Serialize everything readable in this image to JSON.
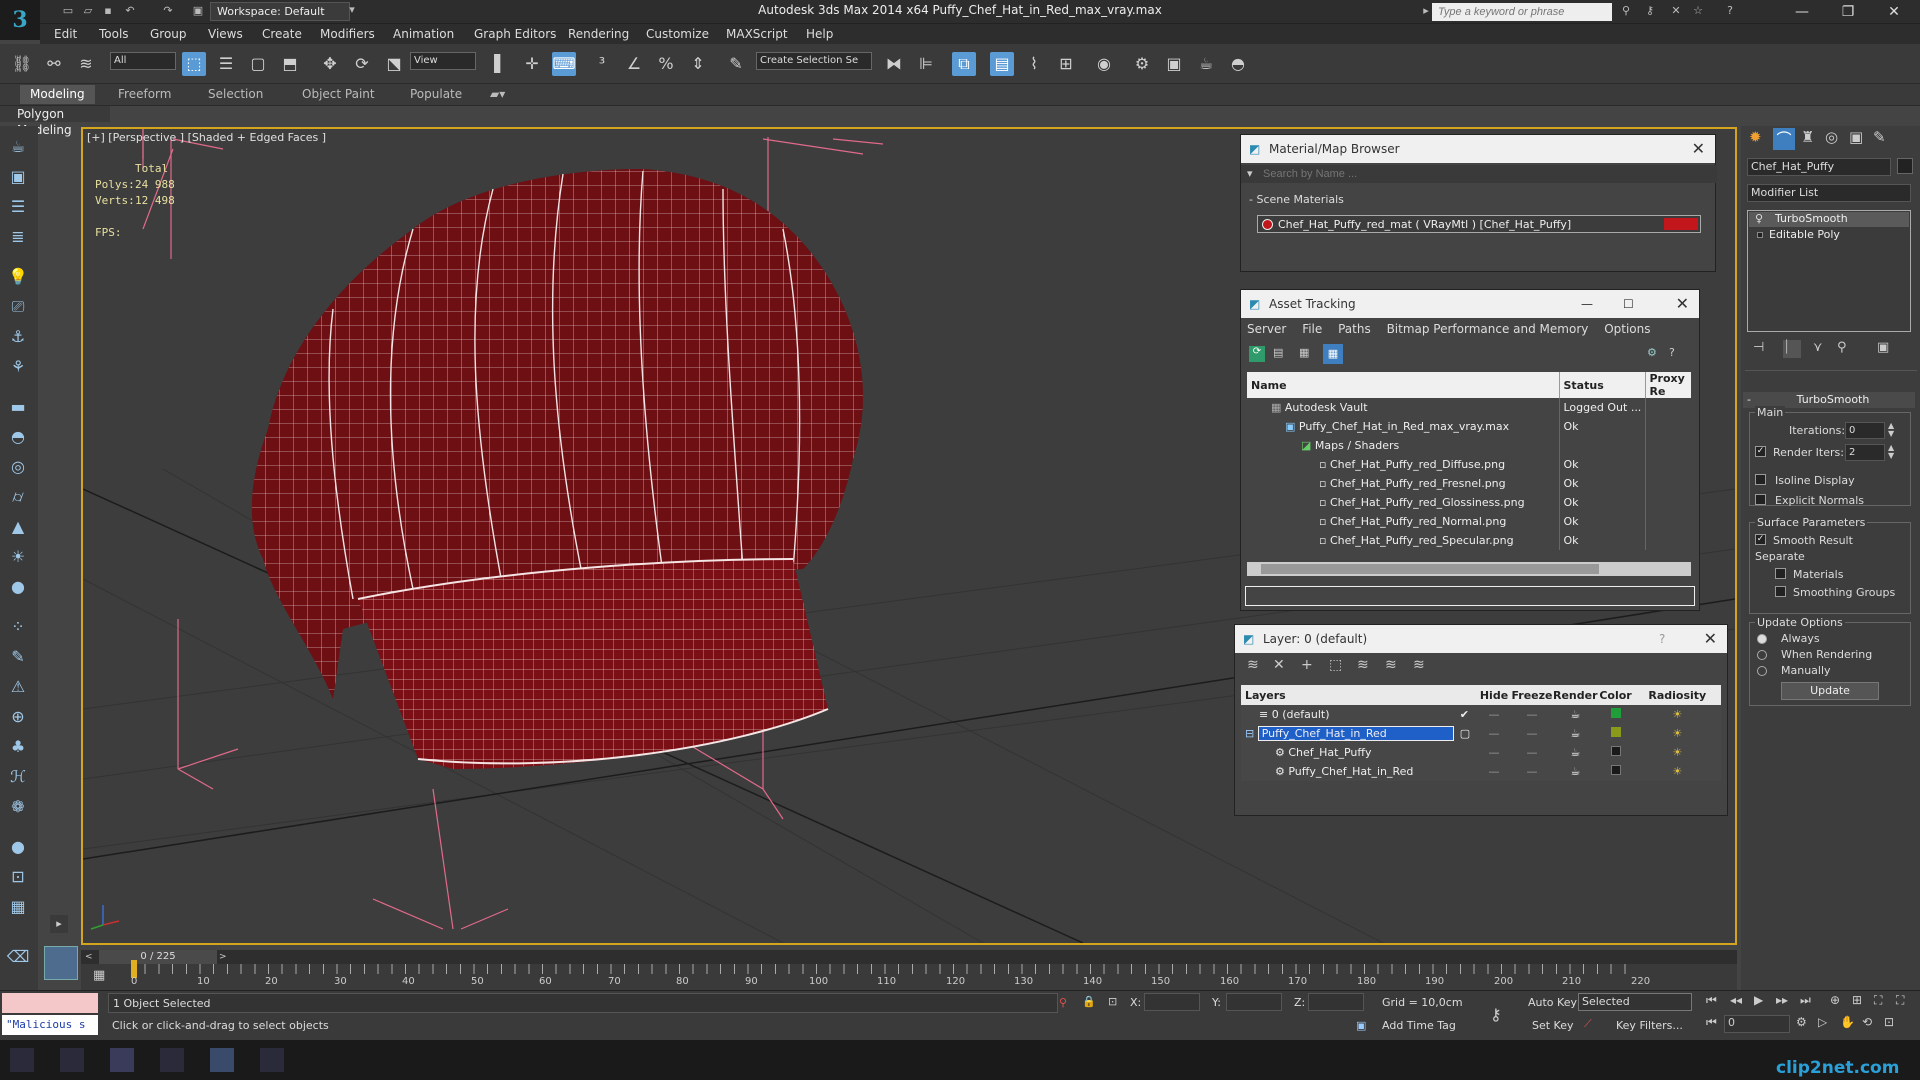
{
  "window": {
    "app_title": "Autodesk 3ds Max  2014 x64     Puffy_Chef_Hat_in_Red_max_vray.max",
    "workspace": "Workspace: Default",
    "search_placeholder": "Type a keyword or phrase"
  },
  "menu": [
    "Edit",
    "Tools",
    "Group",
    "Views",
    "Create",
    "Modifiers",
    "Animation",
    "Graph Editors",
    "Rendering",
    "Customize",
    "MAXScript",
    "Help"
  ],
  "toolbar": {
    "selection_filter": "All",
    "ref_coord": "View",
    "named_selection": "Create Selection Se"
  },
  "ribbon": {
    "tabs": [
      "Modeling",
      "Freeform",
      "Selection",
      "Object Paint",
      "Populate"
    ],
    "active": "Modeling",
    "sub": "Polygon Modeling"
  },
  "viewport": {
    "label": "[+] [Perspective ] [Shaded + Edged Faces ]",
    "stats_header": "Total",
    "polys_label": "Polys:",
    "polys_value": "24 988",
    "verts_label": "Verts:",
    "verts_value": "12 498",
    "fps_label": "FPS:"
  },
  "material_browser": {
    "title": "Material/Map Browser",
    "search_placeholder": "Search by Name ...",
    "section": "- Scene Materials",
    "material": "Chef_Hat_Puffy_red_mat  ( VRayMtl )  [Chef_Hat_Puffy]",
    "swatch_color": "#c0161c"
  },
  "asset_tracking": {
    "title": "Asset Tracking",
    "menu": [
      "Server",
      "File",
      "Paths",
      "Bitmap Performance and Memory",
      "Options"
    ],
    "columns": [
      "Name",
      "Status",
      "Proxy Re"
    ],
    "rows": [
      {
        "name": "Autodesk Vault",
        "status": "Logged Out ..."
      },
      {
        "name": "Puffy_Chef_Hat_in_Red_max_vray.max",
        "status": "Ok"
      },
      {
        "name": "Maps / Shaders",
        "status": ""
      },
      {
        "name": "Chef_Hat_Puffy_red_Diffuse.png",
        "status": "Ok"
      },
      {
        "name": "Chef_Hat_Puffy_red_Fresnel.png",
        "status": "Ok"
      },
      {
        "name": "Chef_Hat_Puffy_red_Glossiness.png",
        "status": "Ok"
      },
      {
        "name": "Chef_Hat_Puffy_red_Normal.png",
        "status": "Ok"
      },
      {
        "name": "Chef_Hat_Puffy_red_Specular.png",
        "status": "Ok"
      }
    ]
  },
  "layers": {
    "title": "Layer: 0 (default)",
    "help": "?",
    "columns": [
      "Layers",
      "Hide",
      "Freeze",
      "Render",
      "Color",
      "Radiosity"
    ],
    "rows": [
      {
        "name": "0 (default)",
        "color": "#1f9e3a"
      },
      {
        "name": "Puffy_Chef_Hat_in_Red",
        "color": "#8a9a1a"
      },
      {
        "name": "Chef_Hat_Puffy",
        "color": "#1a1a1a"
      },
      {
        "name": "Puffy_Chef_Hat_in_Red",
        "color": "#1a1a1a"
      }
    ]
  },
  "command_panel": {
    "object_name": "Chef_Hat_Puffy",
    "modifier_list": "Modifier List",
    "stack": [
      "TurboSmooth",
      "Editable Poly"
    ],
    "rollout_title": "TurboSmooth",
    "main_label": "Main",
    "iterations_label": "Iterations:",
    "iterations_value": "0",
    "render_iters_label": "Render Iters:",
    "render_iters_value": "2",
    "isoline": "Isoline Display",
    "explicit": "Explicit Normals",
    "surface": "Surface Parameters",
    "smooth": "Smooth Result",
    "separate": "Separate",
    "materials": "Materials",
    "smoothing": "Smoothing Groups",
    "update_options": "Update Options",
    "always": "Always",
    "when_rendering": "When Rendering",
    "manually": "Manually",
    "update_button": "Update"
  },
  "timeline": {
    "frame": "0 / 225",
    "ticks": [
      "0",
      "10",
      "20",
      "30",
      "40",
      "50",
      "60",
      "70",
      "80",
      "90",
      "100",
      "110",
      "120",
      "130",
      "140",
      "150",
      "160",
      "170",
      "180",
      "190",
      "200",
      "210",
      "220"
    ]
  },
  "status": {
    "maxscript": "\"Malicious s",
    "selected": "1 Object Selected",
    "prompt": "Click or click-and-drag to select objects",
    "x_label": "X:",
    "y_label": "Y:",
    "z_label": "Z:",
    "grid": "Grid = 10,0cm",
    "add_time_tag": "Add Time Tag",
    "auto_key": "Auto Key",
    "set_key": "Set Key",
    "selected_dd": "Selected",
    "key_filters": "Key Filters...",
    "frame_field": "0"
  },
  "watermark": "clip2net.com"
}
